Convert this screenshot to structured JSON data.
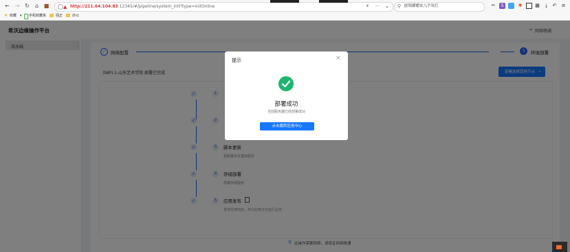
{
  "browser": {
    "url_host": "http://211.64.104.83",
    "url_path": ":12345/#/pipeline/system_init?type=initOnline",
    "more_label": "···",
    "search_placeholder": "欧阳娜娜女儿子骂打",
    "bookmarks": [
      "收藏",
      "手机收藏夹",
      "强正",
      "办公"
    ]
  },
  "app": {
    "title": "希沃边缘操作平台",
    "net_status": "网络畅通"
  },
  "sidebar": {
    "items": [
      {
        "label": "流水线"
      }
    ]
  },
  "steps": [
    {
      "label": "网络配置"
    },
    {
      "label": "环境部署",
      "number": "3"
    }
  ],
  "deploy": {
    "status_text": "3WFI-1-山东艺术学院 部署已完成",
    "dropdown_label": "部署选择其他节点",
    "substeps": [
      {
        "number": "1",
        "title": "",
        "desc": ""
      },
      {
        "number": "2",
        "title": "",
        "desc": ""
      },
      {
        "number": "3",
        "title": "脚本更新",
        "desc": "更新脚本并重启服务"
      },
      {
        "number": "4",
        "title": "存储部署",
        "desc": "部署存储程序"
      },
      {
        "number": "5",
        "title": "应用发布",
        "desc": "发布应用商店，并以应用方式运行业务"
      }
    ]
  },
  "footer": {
    "notice": "此操作需要网络，请保证网络畅通"
  },
  "modal": {
    "title": "提示",
    "close": "×",
    "heading": "部署成功",
    "message": "当前服务器已经部署成功",
    "button": "点击跳转应用中心"
  }
}
